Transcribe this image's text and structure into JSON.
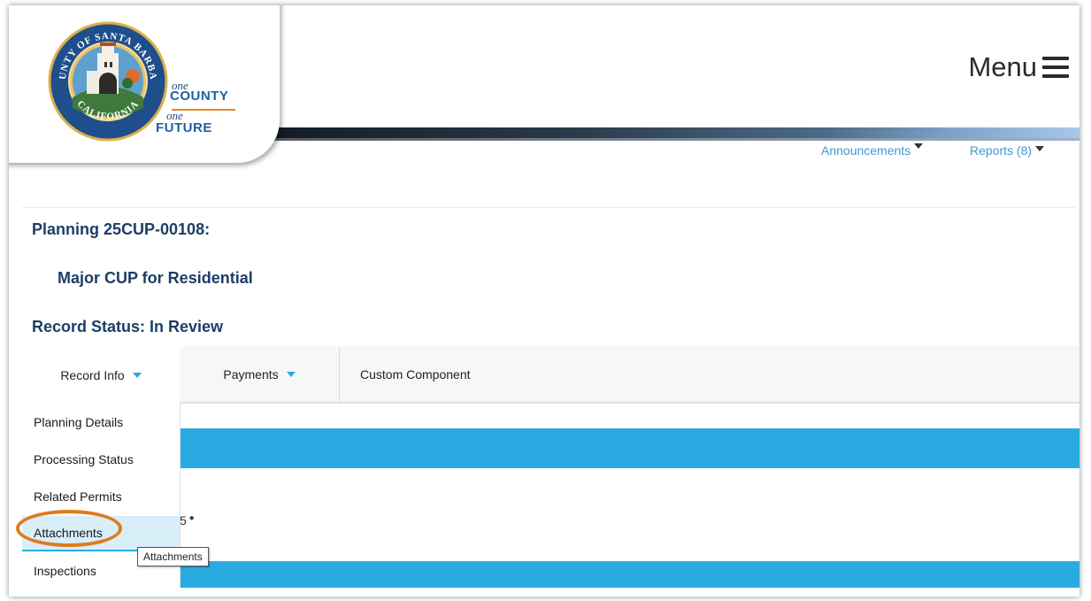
{
  "header": {
    "menu_label": "Menu",
    "logo": {
      "seal_text_top": "COUNTY OF SANTA BARBARA",
      "seal_text_bottom": "CALIFORNIA",
      "tagline_one_1": "one",
      "tagline_county": "COUNTY",
      "tagline_one_2": "one",
      "tagline_future": "FUTURE"
    },
    "links": {
      "announcements": "Announcements",
      "reports": "Reports (8)"
    }
  },
  "record": {
    "title": "Planning 25CUP-00108:",
    "description": "Major CUP for Residential",
    "status": "Record Status: In Review"
  },
  "tabs": {
    "record_info": "Record Info",
    "payments": "Payments",
    "custom_component": "Custom Component"
  },
  "dropdown": {
    "items": [
      {
        "label": "Planning Details"
      },
      {
        "label": "Processing Status"
      },
      {
        "label": "Related Permits"
      },
      {
        "label": "Attachments"
      },
      {
        "label": "Inspections"
      }
    ]
  },
  "tooltip": "Attachments",
  "partial_text": "5",
  "colors": {
    "accent_blue": "#29abe2",
    "title_navy": "#1c3e66",
    "highlight_orange": "#e07a1c",
    "link_blue": "#3a9ad1"
  }
}
